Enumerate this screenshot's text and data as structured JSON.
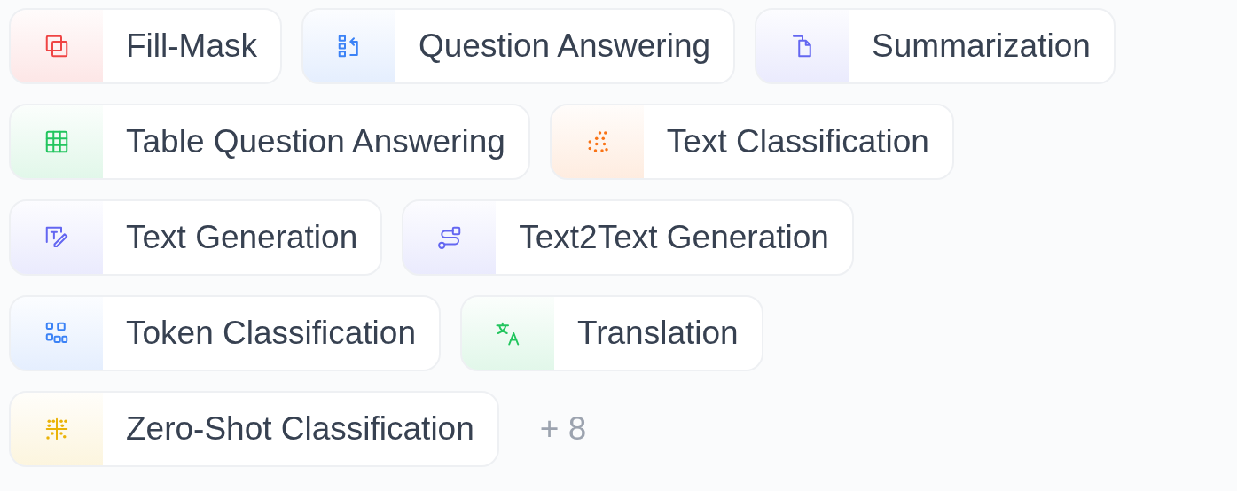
{
  "tag_rows": [
    [
      {
        "label": "Fill-Mask",
        "color": "#ef4444"
      },
      {
        "label": "Question Answering",
        "color": "#3b82f6"
      },
      {
        "label": "Summarization",
        "color": "#6366f1"
      }
    ],
    [
      {
        "label": "Table Question Answering",
        "color": "#22c55e"
      },
      {
        "label": "Text Classification",
        "color": "#f97316"
      }
    ],
    [
      {
        "label": "Text Generation",
        "color": "#6366f1"
      },
      {
        "label": "Text2Text Generation",
        "color": "#6366f1"
      }
    ],
    [
      {
        "label": "Token Classification",
        "color": "#3b82f6"
      },
      {
        "label": "Translation",
        "color": "#22c55e"
      }
    ],
    [
      {
        "label": "Zero-Shot Classification",
        "color": "#eab308"
      }
    ]
  ],
  "more": "+ 8"
}
